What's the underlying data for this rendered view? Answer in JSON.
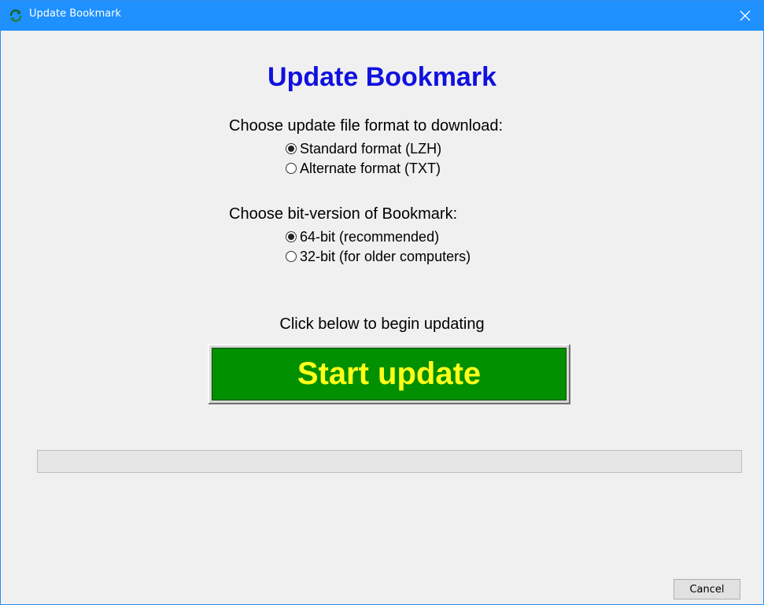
{
  "window": {
    "title": "Update Bookmark",
    "app_icon": "bookmark-update-icon",
    "close_icon": "close-icon",
    "accent_color": "#1e90ff"
  },
  "heading": "Update Bookmark",
  "format_group": {
    "label": "Choose update file format to download:",
    "options": [
      {
        "label": "Standard format (LZH)",
        "checked": true
      },
      {
        "label": "Alternate format (TXT)",
        "checked": false
      }
    ]
  },
  "bit_group": {
    "label": "Choose bit-version of Bookmark:",
    "options": [
      {
        "label": "64-bit (recommended)",
        "checked": true
      },
      {
        "label": "32-bit (for older computers)",
        "checked": false
      }
    ]
  },
  "begin_text": "Click below to begin updating",
  "start_button": {
    "label": "Start update",
    "bg_color": "#009000",
    "text_color": "#ffff1a"
  },
  "progress": {
    "value": 0
  },
  "cancel_button": {
    "label": "Cancel"
  }
}
